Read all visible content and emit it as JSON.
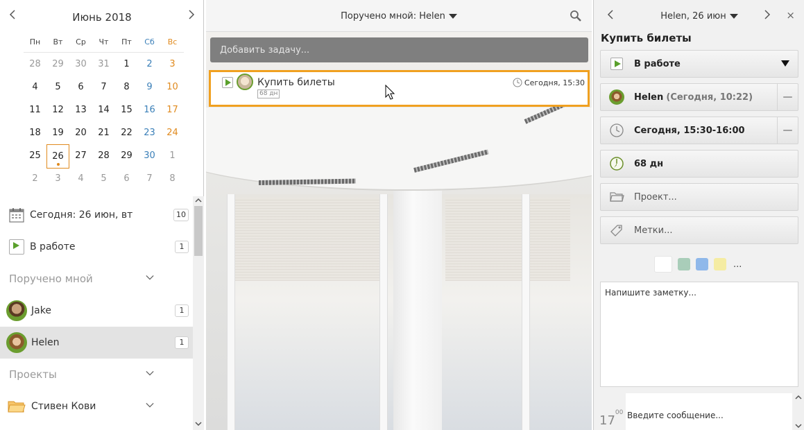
{
  "calendar": {
    "title": "Июнь 2018",
    "weekdays": [
      "Пн",
      "Вт",
      "Ср",
      "Чт",
      "Пт",
      "Сб",
      "Вс"
    ],
    "weeks": [
      [
        "28",
        "29",
        "30",
        "31",
        "1",
        "2",
        "3"
      ],
      [
        "4",
        "5",
        "6",
        "7",
        "8",
        "9",
        "10"
      ],
      [
        "11",
        "12",
        "13",
        "14",
        "15",
        "16",
        "17"
      ],
      [
        "18",
        "19",
        "20",
        "21",
        "22",
        "23",
        "24"
      ],
      [
        "25",
        "26",
        "27",
        "28",
        "29",
        "30",
        "1"
      ],
      [
        "2",
        "3",
        "4",
        "5",
        "6",
        "7",
        "8"
      ]
    ]
  },
  "sidebar": {
    "today": {
      "label": "Сегодня: 26 июн, вт",
      "count": "10"
    },
    "in_progress": {
      "label": "В работе",
      "count": "1"
    },
    "assigned_section": "Поручено мной",
    "people": [
      {
        "name": "Jake",
        "count": "1"
      },
      {
        "name": "Helen",
        "count": "1"
      }
    ],
    "projects_section": "Проекты",
    "project_item": "Стивен Кови"
  },
  "main": {
    "title": "Поручено мной: Helen",
    "add_task_placeholder": "Добавить задачу...",
    "task": {
      "title": "Купить билеты",
      "badge": "68 дн",
      "time": "Сегодня, 15:30"
    }
  },
  "detail": {
    "header": "Helen, 26 июн",
    "close": "×",
    "task_title": "Купить билеты",
    "status": "В работе",
    "assignee_name": "Helen",
    "assignee_time": "(Сегодня, 10:22)",
    "schedule": "Сегодня, 15:30-16:00",
    "duration": "68 дн",
    "project_placeholder": "Проект...",
    "tags_placeholder": "Метки...",
    "colors": [
      "#ffffff",
      "#a9cdb9",
      "#8fb8ea",
      "#f5eca3"
    ],
    "more": "...",
    "note_placeholder": "Напишите заметку...",
    "message_placeholder": "Введите сообщение...",
    "msg_hour": "17",
    "msg_min": "00"
  },
  "accent_color": "#f0a020"
}
